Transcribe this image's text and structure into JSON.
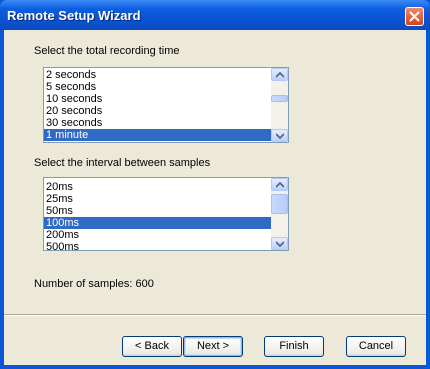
{
  "window": {
    "title": "Remote Setup Wizard"
  },
  "recording_time": {
    "label": "Select the total recording time",
    "items": [
      "2 seconds",
      "5 seconds",
      "10 seconds",
      "20 seconds",
      "30 seconds",
      "1 minute"
    ],
    "selected": "1 minute"
  },
  "sample_interval": {
    "label": "Select the interval between samples",
    "items": [
      "20ms",
      "25ms",
      "50ms",
      "100ms",
      "200ms",
      "500ms"
    ],
    "selected": "100ms"
  },
  "samples_info": "Number of samples: 600",
  "buttons": {
    "back": "< Back",
    "next": "Next >",
    "finish": "Finish",
    "cancel": "Cancel"
  },
  "colors": {
    "title_bar": "#0a58d6",
    "selection": "#316ac5",
    "client_bg": "#ece9d8"
  },
  "icons": [
    "close-icon",
    "scroll-up-arrow-icon",
    "scroll-down-arrow-icon"
  ]
}
